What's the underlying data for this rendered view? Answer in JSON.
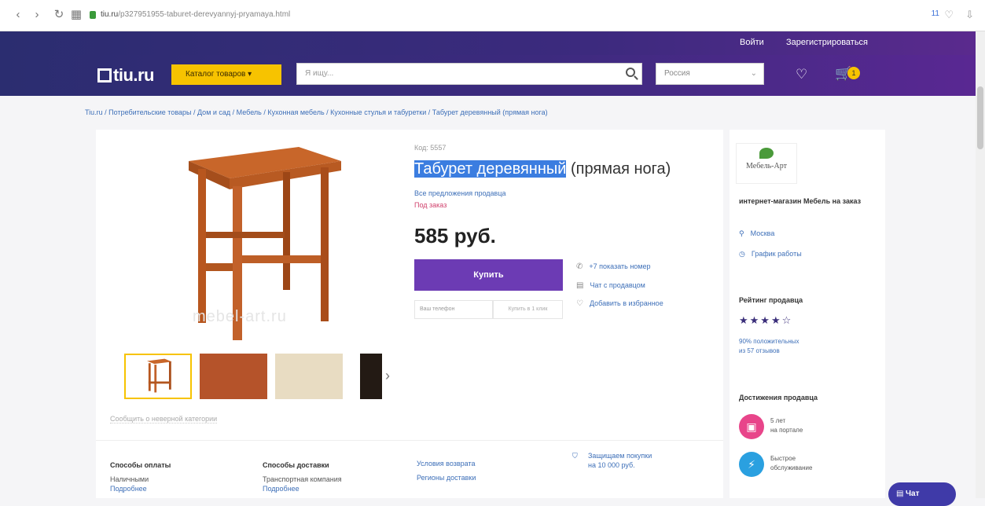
{
  "browser": {
    "address_host": "tiu.ru",
    "address_path": "/p327951955-taburet-derevyannyj-pryamaya.html",
    "ext_badge": "11"
  },
  "header": {
    "login": "Войти",
    "register": "Зарегистрироваться",
    "logo_text": "tiu.ru",
    "catalog_label": "Каталог товаров",
    "search_placeholder": "Я ищу...",
    "region": "Россия",
    "cart_count": "1",
    "colors": {
      "accent": "#f7c300",
      "brand": "#3c2a7e"
    }
  },
  "breadcrumb": "Tiu.ru / Потребительские товары / Дом и сад / Мебель / Кухонная мебель / Кухонные стулья и табуретки / Табурет деревянный (прямая нога)",
  "product": {
    "code": "Код: 5557",
    "title_selected": "Табурет деревянный",
    "title_rest": " (прямая нога)",
    "all_offers": "Все предложения продавца",
    "availability": "Под заказ",
    "price": "585 руб.",
    "buy_label": "Купить",
    "phone_placeholder": "Ваш телефон",
    "one_click_label": "Купить в 1 клик",
    "watermark": "mebel-art.ru",
    "report_link": "Сообщить о неверной категории",
    "actions": [
      {
        "icon": "phone-icon",
        "label": "+7 показать номер"
      },
      {
        "icon": "chat-icon",
        "label": "Чат с продавцом"
      },
      {
        "icon": "heart-icon",
        "label": "Добавить в избранное"
      }
    ],
    "thumbnails": [
      "stool",
      "wood-cherry",
      "wood-light",
      "wood-dark"
    ]
  },
  "seller": {
    "logo_text": "Мебель-Арт",
    "name": "интернет-магазин Мебель на заказ",
    "city": "Москва",
    "schedule": "График работы",
    "rating_title": "Рейтинг продавца",
    "stars": "★★★★☆",
    "positive": "90% положительных",
    "reviews": "из 57 отзывов",
    "achievements_title": "Достижения продавца",
    "ach1_line1": "5 лет",
    "ach1_line2": "на портале",
    "ach2_line1": "Быстрое",
    "ach2_line2": "обслуживание"
  },
  "footer": {
    "pay_title": "Способы оплаты",
    "pay_value": "Наличными",
    "pay_more": "Подробнее",
    "delivery_title": "Способы доставки",
    "delivery_value": "Транспортная компания",
    "delivery_more": "Подробнее",
    "return_link": "Условия возврата",
    "regions_link": "Регионы доставки",
    "protect_line1": "Защищаем покупки",
    "protect_line2": "на 10 000 руб."
  },
  "chat_label": "Чат"
}
